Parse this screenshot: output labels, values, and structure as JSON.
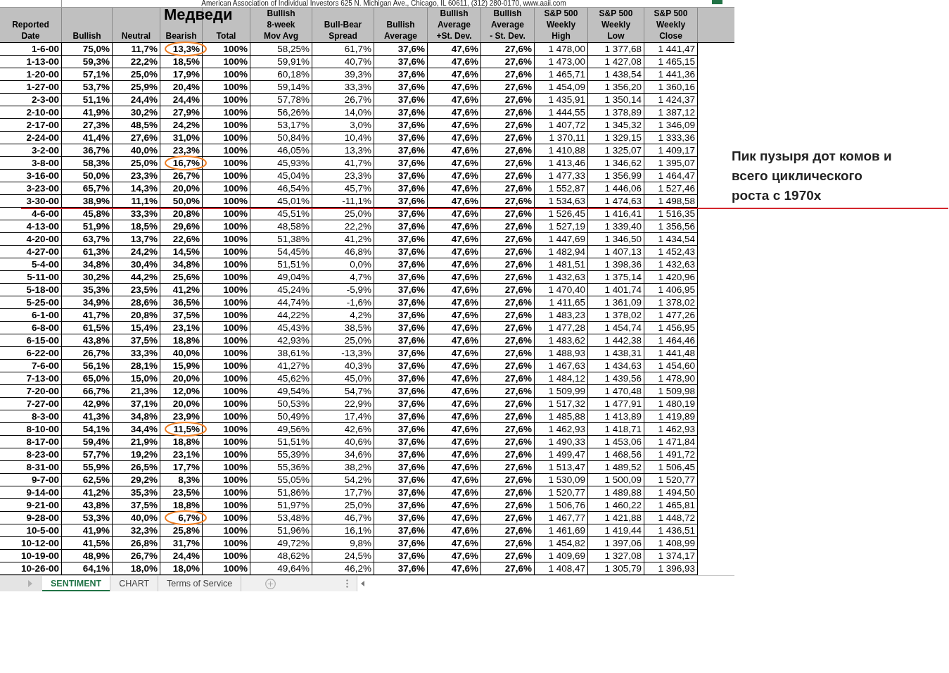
{
  "sheet": {
    "banner": "American Association of Individual Investors 625 N. Michigan Ave., Chicago, IL 60611, (312) 280-0170, www.aaii.com"
  },
  "columns": [
    {
      "label": "Reported\nDate"
    },
    {
      "label": "Bullish"
    },
    {
      "label": "Neutral"
    },
    {
      "label": "Bearish",
      "note": "Медведи"
    },
    {
      "label": "Total"
    },
    {
      "label": "Bullish\n8-week\nMov Avg"
    },
    {
      "label": "Bull-Bear\nSpread"
    },
    {
      "label": "Bullish\nAverage"
    },
    {
      "label": "Bullish\nAverage\n+St. Dev."
    },
    {
      "label": "Bullish\nAverage\n- St. Dev."
    },
    {
      "label": "S&P 500\nWeekly\nHigh"
    },
    {
      "label": "S&P 500\nWeekly\nLow"
    },
    {
      "label": "S&P 500\nWeekly\nClose"
    }
  ],
  "rows": [
    {
      "cells": [
        "1-6-00",
        "75,0%",
        "11,7%",
        "13,3%",
        "100%",
        "58,25%",
        "61,7%",
        "37,6%",
        "47,6%",
        "27,6%",
        "1 478,00",
        "1 377,68",
        "1 441,47"
      ],
      "circled": true,
      "peak_line": false
    },
    {
      "cells": [
        "1-13-00",
        "59,3%",
        "22,2%",
        "18,5%",
        "100%",
        "59,91%",
        "40,7%",
        "37,6%",
        "47,6%",
        "27,6%",
        "1 473,00",
        "1 427,08",
        "1 465,15"
      ],
      "circled": false,
      "peak_line": false
    },
    {
      "cells": [
        "1-20-00",
        "57,1%",
        "25,0%",
        "17,9%",
        "100%",
        "60,18%",
        "39,3%",
        "37,6%",
        "47,6%",
        "27,6%",
        "1 465,71",
        "1 438,54",
        "1 441,36"
      ],
      "circled": false,
      "peak_line": false
    },
    {
      "cells": [
        "1-27-00",
        "53,7%",
        "25,9%",
        "20,4%",
        "100%",
        "59,14%",
        "33,3%",
        "37,6%",
        "47,6%",
        "27,6%",
        "1 454,09",
        "1 356,20",
        "1 360,16"
      ],
      "circled": false,
      "peak_line": false
    },
    {
      "cells": [
        "2-3-00",
        "51,1%",
        "24,4%",
        "24,4%",
        "100%",
        "57,78%",
        "26,7%",
        "37,6%",
        "47,6%",
        "27,6%",
        "1 435,91",
        "1 350,14",
        "1 424,37"
      ],
      "circled": false,
      "peak_line": false
    },
    {
      "cells": [
        "2-10-00",
        "41,9%",
        "30,2%",
        "27,9%",
        "100%",
        "56,26%",
        "14,0%",
        "37,6%",
        "47,6%",
        "27,6%",
        "1 444,55",
        "1 378,89",
        "1 387,12"
      ],
      "circled": false,
      "peak_line": false
    },
    {
      "cells": [
        "2-17-00",
        "27,3%",
        "48,5%",
        "24,2%",
        "100%",
        "53,17%",
        "3,0%",
        "37,6%",
        "47,6%",
        "27,6%",
        "1 407,72",
        "1 345,32",
        "1 346,09"
      ],
      "circled": false,
      "peak_line": false
    },
    {
      "cells": [
        "2-24-00",
        "41,4%",
        "27,6%",
        "31,0%",
        "100%",
        "50,84%",
        "10,4%",
        "37,6%",
        "47,6%",
        "27,6%",
        "1 370,11",
        "1 329,15",
        "1 333,36"
      ],
      "circled": false,
      "peak_line": false
    },
    {
      "cells": [
        "3-2-00",
        "36,7%",
        "40,0%",
        "23,3%",
        "100%",
        "46,05%",
        "13,3%",
        "37,6%",
        "47,6%",
        "27,6%",
        "1 410,88",
        "1 325,07",
        "1 409,17"
      ],
      "circled": false,
      "peak_line": false
    },
    {
      "cells": [
        "3-8-00",
        "58,3%",
        "25,0%",
        "16,7%",
        "100%",
        "45,93%",
        "41,7%",
        "37,6%",
        "47,6%",
        "27,6%",
        "1 413,46",
        "1 346,62",
        "1 395,07"
      ],
      "circled": true,
      "peak_line": false
    },
    {
      "cells": [
        "3-16-00",
        "50,0%",
        "23,3%",
        "26,7%",
        "100%",
        "45,04%",
        "23,3%",
        "37,6%",
        "47,6%",
        "27,6%",
        "1 477,33",
        "1 356,99",
        "1 464,47"
      ],
      "circled": false,
      "peak_line": false
    },
    {
      "cells": [
        "3-23-00",
        "65,7%",
        "14,3%",
        "20,0%",
        "100%",
        "46,54%",
        "45,7%",
        "37,6%",
        "47,6%",
        "27,6%",
        "1 552,87",
        "1 446,06",
        "1 527,46"
      ],
      "circled": false,
      "peak_line": false
    },
    {
      "cells": [
        "3-30-00",
        "38,9%",
        "11,1%",
        "50,0%",
        "100%",
        "45,01%",
        "-11,1%",
        "37,6%",
        "47,6%",
        "27,6%",
        "1 534,63",
        "1 474,63",
        "1 498,58"
      ],
      "circled": false,
      "peak_line": true
    },
    {
      "cells": [
        "4-6-00",
        "45,8%",
        "33,3%",
        "20,8%",
        "100%",
        "45,51%",
        "25,0%",
        "37,6%",
        "47,6%",
        "27,6%",
        "1 526,45",
        "1 416,41",
        "1 516,35"
      ],
      "circled": false,
      "peak_line": false
    },
    {
      "cells": [
        "4-13-00",
        "51,9%",
        "18,5%",
        "29,6%",
        "100%",
        "48,58%",
        "22,2%",
        "37,6%",
        "47,6%",
        "27,6%",
        "1 527,19",
        "1 339,40",
        "1 356,56"
      ],
      "circled": false,
      "peak_line": false
    },
    {
      "cells": [
        "4-20-00",
        "63,7%",
        "13,7%",
        "22,6%",
        "100%",
        "51,38%",
        "41,2%",
        "37,6%",
        "47,6%",
        "27,6%",
        "1 447,69",
        "1 346,50",
        "1 434,54"
      ],
      "circled": false,
      "peak_line": false
    },
    {
      "cells": [
        "4-27-00",
        "61,3%",
        "24,2%",
        "14,5%",
        "100%",
        "54,45%",
        "46,8%",
        "37,6%",
        "47,6%",
        "27,6%",
        "1 482,94",
        "1 407,13",
        "1 452,43"
      ],
      "circled": false,
      "peak_line": false
    },
    {
      "cells": [
        "5-4-00",
        "34,8%",
        "30,4%",
        "34,8%",
        "100%",
        "51,51%",
        "0,0%",
        "37,6%",
        "47,6%",
        "27,6%",
        "1 481,51",
        "1 398,36",
        "1 432,63"
      ],
      "circled": false,
      "peak_line": false
    },
    {
      "cells": [
        "5-11-00",
        "30,2%",
        "44,2%",
        "25,6%",
        "100%",
        "49,04%",
        "4,7%",
        "37,6%",
        "47,6%",
        "27,6%",
        "1 432,63",
        "1 375,14",
        "1 420,96"
      ],
      "circled": false,
      "peak_line": false
    },
    {
      "cells": [
        "5-18-00",
        "35,3%",
        "23,5%",
        "41,2%",
        "100%",
        "45,24%",
        "-5,9%",
        "37,6%",
        "47,6%",
        "27,6%",
        "1 470,40",
        "1 401,74",
        "1 406,95"
      ],
      "circled": false,
      "peak_line": false
    },
    {
      "cells": [
        "5-25-00",
        "34,9%",
        "28,6%",
        "36,5%",
        "100%",
        "44,74%",
        "-1,6%",
        "37,6%",
        "47,6%",
        "27,6%",
        "1 411,65",
        "1 361,09",
        "1 378,02"
      ],
      "circled": false,
      "peak_line": false
    },
    {
      "cells": [
        "6-1-00",
        "41,7%",
        "20,8%",
        "37,5%",
        "100%",
        "44,22%",
        "4,2%",
        "37,6%",
        "47,6%",
        "27,6%",
        "1 483,23",
        "1 378,02",
        "1 477,26"
      ],
      "circled": false,
      "peak_line": false
    },
    {
      "cells": [
        "6-8-00",
        "61,5%",
        "15,4%",
        "23,1%",
        "100%",
        "45,43%",
        "38,5%",
        "37,6%",
        "47,6%",
        "27,6%",
        "1 477,28",
        "1 454,74",
        "1 456,95"
      ],
      "circled": false,
      "peak_line": false
    },
    {
      "cells": [
        "6-15-00",
        "43,8%",
        "37,5%",
        "18,8%",
        "100%",
        "42,93%",
        "25,0%",
        "37,6%",
        "47,6%",
        "27,6%",
        "1 483,62",
        "1 442,38",
        "1 464,46"
      ],
      "circled": false,
      "peak_line": false
    },
    {
      "cells": [
        "6-22-00",
        "26,7%",
        "33,3%",
        "40,0%",
        "100%",
        "38,61%",
        "-13,3%",
        "37,6%",
        "47,6%",
        "27,6%",
        "1 488,93",
        "1 438,31",
        "1 441,48"
      ],
      "circled": false,
      "peak_line": false
    },
    {
      "cells": [
        "7-6-00",
        "56,1%",
        "28,1%",
        "15,9%",
        "100%",
        "41,27%",
        "40,3%",
        "37,6%",
        "47,6%",
        "27,6%",
        "1 467,63",
        "1 434,63",
        "1 454,60"
      ],
      "circled": false,
      "peak_line": false
    },
    {
      "cells": [
        "7-13-00",
        "65,0%",
        "15,0%",
        "20,0%",
        "100%",
        "45,62%",
        "45,0%",
        "37,6%",
        "47,6%",
        "27,6%",
        "1 484,12",
        "1 439,56",
        "1 478,90"
      ],
      "circled": false,
      "peak_line": false
    },
    {
      "cells": [
        "7-20-00",
        "66,7%",
        "21,3%",
        "12,0%",
        "100%",
        "49,54%",
        "54,7%",
        "37,6%",
        "47,6%",
        "27,6%",
        "1 509,99",
        "1 470,48",
        "1 509,98"
      ],
      "circled": false,
      "peak_line": false
    },
    {
      "cells": [
        "7-27-00",
        "42,9%",
        "37,1%",
        "20,0%",
        "100%",
        "50,53%",
        "22,9%",
        "37,6%",
        "47,6%",
        "27,6%",
        "1 517,32",
        "1 477,91",
        "1 480,19"
      ],
      "circled": false,
      "peak_line": false
    },
    {
      "cells": [
        "8-3-00",
        "41,3%",
        "34,8%",
        "23,9%",
        "100%",
        "50,49%",
        "17,4%",
        "37,6%",
        "47,6%",
        "27,6%",
        "1 485,88",
        "1 413,89",
        "1 419,89"
      ],
      "circled": false,
      "peak_line": false
    },
    {
      "cells": [
        "8-10-00",
        "54,1%",
        "34,4%",
        "11,5%",
        "100%",
        "49,56%",
        "42,6%",
        "37,6%",
        "47,6%",
        "27,6%",
        "1 462,93",
        "1 418,71",
        "1 462,93"
      ],
      "circled": true,
      "peak_line": false
    },
    {
      "cells": [
        "8-17-00",
        "59,4%",
        "21,9%",
        "18,8%",
        "100%",
        "51,51%",
        "40,6%",
        "37,6%",
        "47,6%",
        "27,6%",
        "1 490,33",
        "1 453,06",
        "1 471,84"
      ],
      "circled": false,
      "peak_line": false
    },
    {
      "cells": [
        "8-23-00",
        "57,7%",
        "19,2%",
        "23,1%",
        "100%",
        "55,39%",
        "34,6%",
        "37,6%",
        "47,6%",
        "27,6%",
        "1 499,47",
        "1 468,56",
        "1 491,72"
      ],
      "circled": false,
      "peak_line": false
    },
    {
      "cells": [
        "8-31-00",
        "55,9%",
        "26,5%",
        "17,7%",
        "100%",
        "55,36%",
        "38,2%",
        "37,6%",
        "47,6%",
        "27,6%",
        "1 513,47",
        "1 489,52",
        "1 506,45"
      ],
      "circled": false,
      "peak_line": false
    },
    {
      "cells": [
        "9-7-00",
        "62,5%",
        "29,2%",
        "8,3%",
        "100%",
        "55,05%",
        "54,2%",
        "37,6%",
        "47,6%",
        "27,6%",
        "1 530,09",
        "1 500,09",
        "1 520,77"
      ],
      "circled": false,
      "peak_line": false
    },
    {
      "cells": [
        "9-14-00",
        "41,2%",
        "35,3%",
        "23,5%",
        "100%",
        "51,86%",
        "17,7%",
        "37,6%",
        "47,6%",
        "27,6%",
        "1 520,77",
        "1 489,88",
        "1 494,50"
      ],
      "circled": false,
      "peak_line": false
    },
    {
      "cells": [
        "9-21-00",
        "43,8%",
        "37,5%",
        "18,8%",
        "100%",
        "51,97%",
        "25,0%",
        "37,6%",
        "47,6%",
        "27,6%",
        "1 506,76",
        "1 460,22",
        "1 465,81"
      ],
      "circled": false,
      "peak_line": false
    },
    {
      "cells": [
        "9-28-00",
        "53,3%",
        "40,0%",
        "6,7%",
        "100%",
        "53,48%",
        "46,7%",
        "37,6%",
        "47,6%",
        "27,6%",
        "1 467,77",
        "1 421,88",
        "1 448,72"
      ],
      "circled": true,
      "peak_line": false
    },
    {
      "cells": [
        "10-5-00",
        "41,9%",
        "32,3%",
        "25,8%",
        "100%",
        "51,96%",
        "16,1%",
        "37,6%",
        "47,6%",
        "27,6%",
        "1 461,69",
        "1 419,44",
        "1 436,51"
      ],
      "circled": false,
      "peak_line": false
    },
    {
      "cells": [
        "10-12-00",
        "41,5%",
        "26,8%",
        "31,7%",
        "100%",
        "49,72%",
        "9,8%",
        "37,6%",
        "47,6%",
        "27,6%",
        "1 454,82",
        "1 397,06",
        "1 408,99"
      ],
      "circled": false,
      "peak_line": false
    },
    {
      "cells": [
        "10-19-00",
        "48,9%",
        "26,7%",
        "24,4%",
        "100%",
        "48,62%",
        "24,5%",
        "37,6%",
        "47,6%",
        "27,6%",
        "1 409,69",
        "1 327,08",
        "1 374,17"
      ],
      "circled": false,
      "peak_line": false
    },
    {
      "cells": [
        "10-26-00",
        "64,1%",
        "18,0%",
        "18,0%",
        "100%",
        "49,64%",
        "46,2%",
        "37,6%",
        "47,6%",
        "27,6%",
        "1 408,47",
        "1 305,79",
        "1 396,93"
      ],
      "circled": false,
      "peak_line": false
    }
  ],
  "sheet_tabs": [
    {
      "label": "SENTIMENT",
      "selected": true
    },
    {
      "label": "CHART",
      "selected": false
    },
    {
      "label": "Terms of Service",
      "selected": false
    }
  ],
  "annotation": {
    "text": "Пик пузыря дот комов и\nвсего циклического\nроста с 1970х"
  }
}
